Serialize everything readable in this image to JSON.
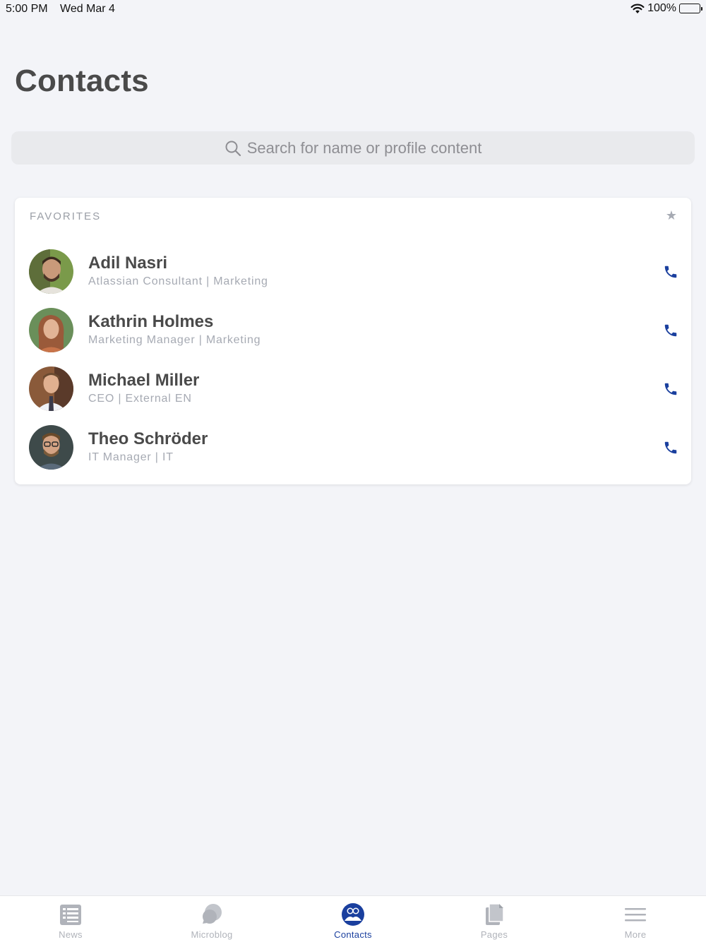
{
  "status_bar": {
    "time": "5:00 PM",
    "date": "Wed Mar 4",
    "battery": "100%"
  },
  "page": {
    "title": "Contacts"
  },
  "search": {
    "placeholder": "Search for name or profile content"
  },
  "favorites": {
    "header": "FAVORITES",
    "contacts": [
      {
        "name": "Adil Nasri",
        "subtitle": "Atlassian Consultant | Marketing"
      },
      {
        "name": "Kathrin Holmes",
        "subtitle": "Marketing Manager | Marketing"
      },
      {
        "name": "Michael Miller",
        "subtitle": "CEO | External EN"
      },
      {
        "name": "Theo Schröder",
        "subtitle": "IT Manager | IT"
      }
    ]
  },
  "tab_bar": {
    "tabs": [
      {
        "label": "News",
        "icon": "news-icon"
      },
      {
        "label": "Microblog",
        "icon": "chat-bubble-icon"
      },
      {
        "label": "Contacts",
        "icon": "contacts-icon",
        "active": true
      },
      {
        "label": "Pages",
        "icon": "pages-icon"
      },
      {
        "label": "More",
        "icon": "menu-icon"
      }
    ]
  },
  "colors": {
    "accent": "#1a3f9e",
    "inactive": "#b0b3ba",
    "background": "#f3f4f8"
  }
}
